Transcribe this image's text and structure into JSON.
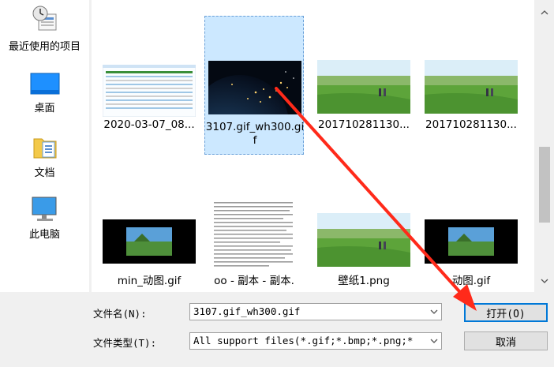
{
  "places": [
    {
      "label": "最近使用的项目",
      "icon": "recent-items-icon"
    },
    {
      "label": "桌面",
      "icon": "desktop-icon"
    },
    {
      "label": "文档",
      "icon": "documents-icon"
    },
    {
      "label": "此电脑",
      "icon": "this-pc-icon"
    }
  ],
  "files": [
    {
      "name": "2020-03-07_08...",
      "thumb": "webpage-screenshot"
    },
    {
      "name": "3107.gif_wh300.gif",
      "thumb": "earth-night",
      "selected": true
    },
    {
      "name": "201710281130...",
      "thumb": "green-field"
    },
    {
      "name": "201710281130...",
      "thumb": "green-field"
    },
    {
      "name": "min_动图.gif",
      "thumb": "landscape-dark"
    },
    {
      "name": "oo - 副本 - 副本.",
      "thumb": "text-document"
    },
    {
      "name": "壁纸1.png",
      "thumb": "green-field"
    },
    {
      "name": "动图.gif",
      "thumb": "landscape-dark"
    }
  ],
  "filename": {
    "label": "文件名(N):",
    "value": "3107.gif_wh300.gif"
  },
  "filetype": {
    "label": "文件类型(T):",
    "value": "All support files(*.gif;*.bmp;*.png;*"
  },
  "buttons": {
    "open": "打开(O)",
    "cancel": "取消"
  },
  "colors": {
    "selection_fill": "#cce8ff",
    "arrow": "#ff2a1a",
    "primary_border": "#0078d7"
  }
}
